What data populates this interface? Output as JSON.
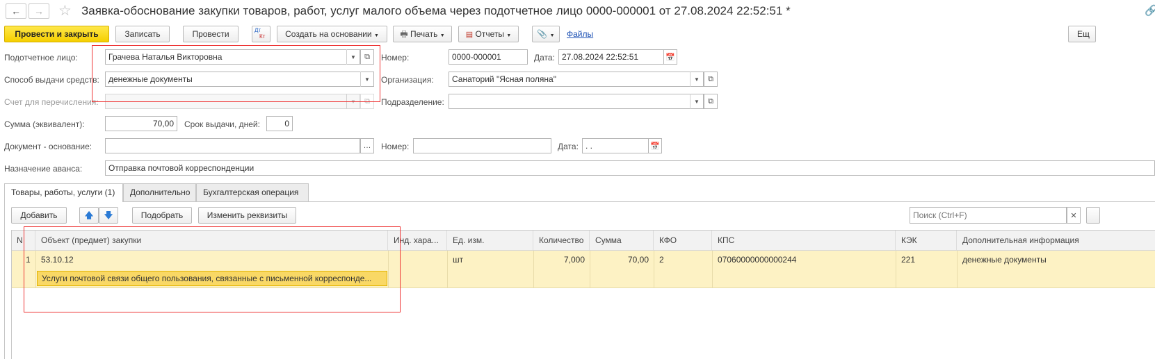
{
  "window": {
    "title": "Заявка-обоснование закупки товаров, работ, услуг малого объема через подотчетное лицо 0000-000001 от 27.08.2024 22:52:51 *"
  },
  "toolbar": {
    "post_close": "Провести и закрыть",
    "write": "Записать",
    "post": "Провести",
    "dtkt_top": "Дт",
    "dtkt_bottom": "Кт",
    "create_based": "Создать на основании",
    "print": "Печать",
    "reports": "Отчеты",
    "files": "Файлы",
    "more": "Ещ"
  },
  "form": {
    "accountable_label": "Подотчетное лицо:",
    "accountable_value": "Грачева Наталья Викторовна",
    "method_label": "Способ выдачи средств:",
    "method_value": "денежные документы",
    "account_label": "Счет для перечисления:",
    "account_value": "",
    "number_label": "Номер:",
    "number_value": "0000-000001",
    "date_label": "Дата:",
    "date_value": "27.08.2024 22:52:51",
    "org_label": "Организация:",
    "org_value": "Санаторий \"Ясная поляна\"",
    "division_label": "Подразделение:",
    "division_value": "",
    "sum_label": "Сумма (эквивалент):",
    "sum_value": "70,00",
    "term_label": "Срок выдачи, дней:",
    "term_value": "0",
    "basis_label": "Документ - основание:",
    "basis_value": "",
    "basis_number_label": "Номер:",
    "basis_number_value": "",
    "basis_date_label": "Дата:",
    "basis_date_value": " .  .",
    "purpose_label": "Назначение аванса:",
    "purpose_value": "Отправка почтовой корреспонденции"
  },
  "tabs": [
    {
      "label": "Товары, работы, услуги (1)"
    },
    {
      "label": "Дополнительно"
    },
    {
      "label": "Бухгалтерская операция"
    }
  ],
  "table_toolbar": {
    "add": "Добавить",
    "select": "Подобрать",
    "change": "Изменить реквизиты",
    "search_placeholder": "Поиск (Ctrl+F)"
  },
  "table": {
    "columns": [
      "N",
      "Объект (предмет) закупки",
      "Инд. хара...",
      "Ед. изм.",
      "Количество",
      "Сумма",
      "КФО",
      "КПС",
      "КЭК",
      "Дополнительная информация"
    ],
    "rows": [
      {
        "n": "1",
        "object_code": "53.10.12",
        "object_name": "Услуги почтовой связи общего пользования, связанные с письменной корреспонде...",
        "ind": "",
        "unit": "шт",
        "qty": "7,000",
        "sum": "70,00",
        "kfo": "2",
        "kps": "07060000000000244",
        "kek": "221",
        "info": "денежные документы"
      }
    ]
  },
  "colors": {
    "accent_yellow": "#f5cf00",
    "row_highlight": "#fdf2c4",
    "annotation_red": "#e33333",
    "link": "#1a4fb3"
  }
}
